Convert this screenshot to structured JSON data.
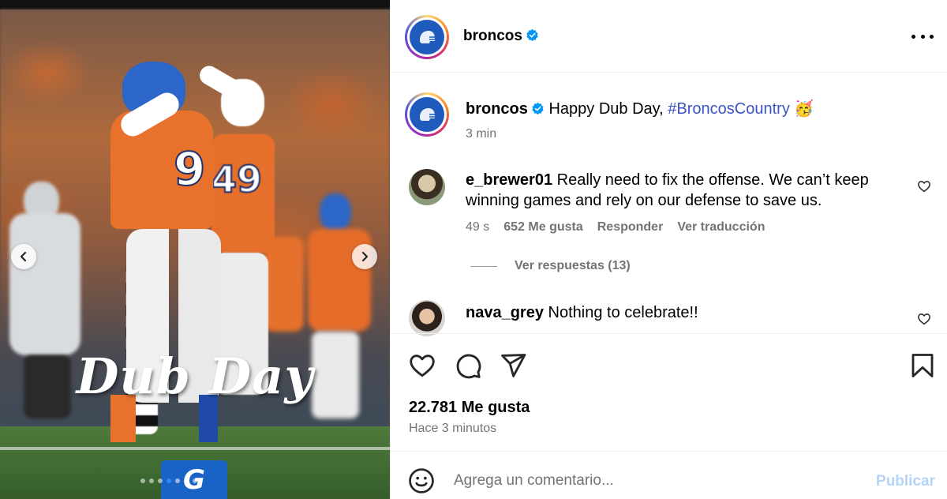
{
  "media": {
    "overlay_text": "Dub Day",
    "jersey_main": "9",
    "jersey_second": "49",
    "carousel_dot_count": 7,
    "carousel_active_index": 3,
    "sponsor_glyph": "G"
  },
  "post": {
    "author": "broncos",
    "verified": true,
    "caption_author": "broncos",
    "caption_text": "Happy Dub Day,",
    "caption_hashtag": "#BroncosCountry",
    "caption_emoji": "🥳",
    "caption_time": "3 min",
    "likes_total": "22.781 Me gusta",
    "posted_time": "Hace 3 minutos"
  },
  "comments": [
    {
      "username": "e_brewer01",
      "text": "Really need to fix the offense. We can’t keep winning games and rely on our defense to save us.",
      "time": "49 s",
      "likes": "652 Me gusta",
      "reply_label": "Responder",
      "translate_label": "Ver traducción",
      "view_replies": "Ver respuestas (13)"
    },
    {
      "username": "nava_grey",
      "text": "Nothing to celebrate!!"
    }
  ],
  "composer": {
    "placeholder": "Agrega un comentario...",
    "publish_label": "Publicar"
  },
  "colors": {
    "verified_blue": "#0095f6",
    "hashtag": "#3b53c4",
    "publish_disabled": "#b3d3f7",
    "secondary_text": "#737373"
  },
  "icons": [
    "chevron-left-icon",
    "chevron-right-icon",
    "verified-badge-icon",
    "more-icon",
    "heart-icon",
    "comment-icon",
    "share-icon",
    "bookmark-icon",
    "emoji-icon"
  ]
}
